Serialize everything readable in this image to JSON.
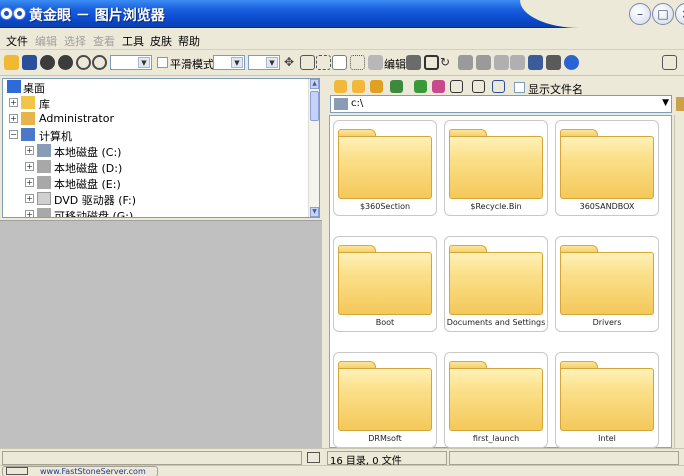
{
  "window": {
    "title": "黄金眼 － 图片浏览器"
  },
  "menu": [
    {
      "label": "文件",
      "enabled": true
    },
    {
      "label": "编辑",
      "enabled": false
    },
    {
      "label": "选择",
      "enabled": false
    },
    {
      "label": "查看",
      "enabled": false
    },
    {
      "label": "工具",
      "enabled": true
    },
    {
      "label": "皮肤",
      "enabled": true
    },
    {
      "label": "帮助",
      "enabled": true
    }
  ],
  "toolbar": {
    "smooth_mode_label": "平滑模式",
    "edit_label": "编辑"
  },
  "tree": {
    "items": [
      {
        "label": "桌面",
        "icon": "desktop-icon"
      },
      {
        "label": "库",
        "icon": "library-icon"
      },
      {
        "label": "Administrator",
        "icon": "user-folder-icon"
      },
      {
        "label": "计算机",
        "icon": "computer-icon"
      },
      {
        "label": "本地磁盘 (C:)",
        "icon": "system-drive-icon"
      },
      {
        "label": "本地磁盘 (D:)",
        "icon": "drive-icon"
      },
      {
        "label": "本地磁盘 (E:)",
        "icon": "drive-icon"
      },
      {
        "label": "DVD 驱动器 (F:)",
        "icon": "dvd-drive-icon"
      },
      {
        "label": "可移动磁盘 (G:)",
        "icon": "removable-drive-icon"
      }
    ]
  },
  "right_toolbar": {
    "show_filenames_label": "显示文件名"
  },
  "path": {
    "value": "c:\\"
  },
  "folders": [
    {
      "name": "$360Section"
    },
    {
      "name": "$Recycle.Bin"
    },
    {
      "name": "360SANDBOX"
    },
    {
      "name": "Boot"
    },
    {
      "name": "Documents and Settings"
    },
    {
      "name": "Drivers"
    },
    {
      "name": "DRMsoft"
    },
    {
      "name": "first_launch"
    },
    {
      "name": "Intel"
    }
  ],
  "status": {
    "text": "16 目录, 0 文件"
  },
  "taskbar": {
    "text": "www.FastStoneServer.com"
  },
  "colors": {
    "titlebar": "#0b4bd1",
    "folder": "#f4c85a",
    "panel_bg": "#ece9d8"
  }
}
